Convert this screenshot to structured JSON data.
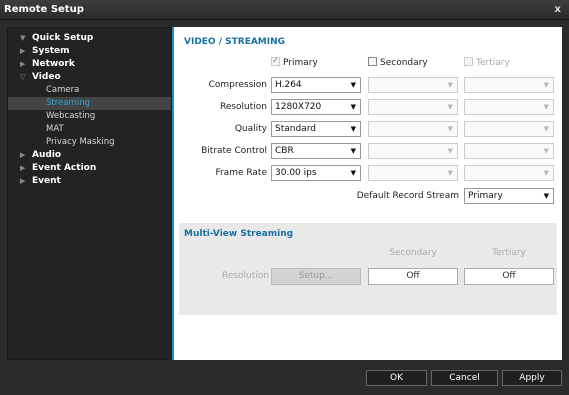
{
  "window": {
    "title": "Remote Setup",
    "close_label": "x"
  },
  "sidebar": {
    "items": [
      {
        "label": "Quick Setup",
        "arrow": "▼"
      },
      {
        "label": "System",
        "arrow": "▶"
      },
      {
        "label": "Network",
        "arrow": "▶"
      },
      {
        "label": "Video",
        "arrow": "▽"
      },
      {
        "label": "Audio",
        "arrow": "▶"
      },
      {
        "label": "Event Action",
        "arrow": "▶"
      },
      {
        "label": "Event",
        "arrow": "▶"
      }
    ],
    "video_sub": [
      "Camera",
      "Streaming",
      "Webcasting",
      "MAT",
      "Privacy Masking"
    ],
    "active_sub": "Streaming"
  },
  "main": {
    "title": "VIDEO / STREAMING",
    "streams": {
      "primary": {
        "label": "Primary",
        "checked": true
      },
      "secondary": {
        "label": "Secondary",
        "checked": false
      },
      "tertiary": {
        "label": "Tertiary",
        "checked": false
      }
    },
    "rows": [
      {
        "label": "Compression",
        "value": "H.264"
      },
      {
        "label": "Resolution",
        "value": "1280X720"
      },
      {
        "label": "Quality",
        "value": "Standard"
      },
      {
        "label": "Bitrate Control",
        "value": "CBR"
      },
      {
        "label": "Frame Rate",
        "value": "30.00 ips"
      }
    ],
    "default_record": {
      "label": "Default Record Stream",
      "value": "Primary"
    }
  },
  "multiview": {
    "title": "Multi-View Streaming",
    "col_secondary": "Secondary",
    "col_tertiary": "Tertiary",
    "resolution_label": "Resolution",
    "setup_label": "Setup...",
    "secondary_value": "Off",
    "tertiary_value": "Off"
  },
  "dialog": {
    "ok": "OK",
    "cancel": "Cancel",
    "apply": "Apply"
  },
  "colors": {
    "accent": "#1b8fd1",
    "active_text": "#2ea3e0",
    "section_title": "#1a6fa3"
  }
}
